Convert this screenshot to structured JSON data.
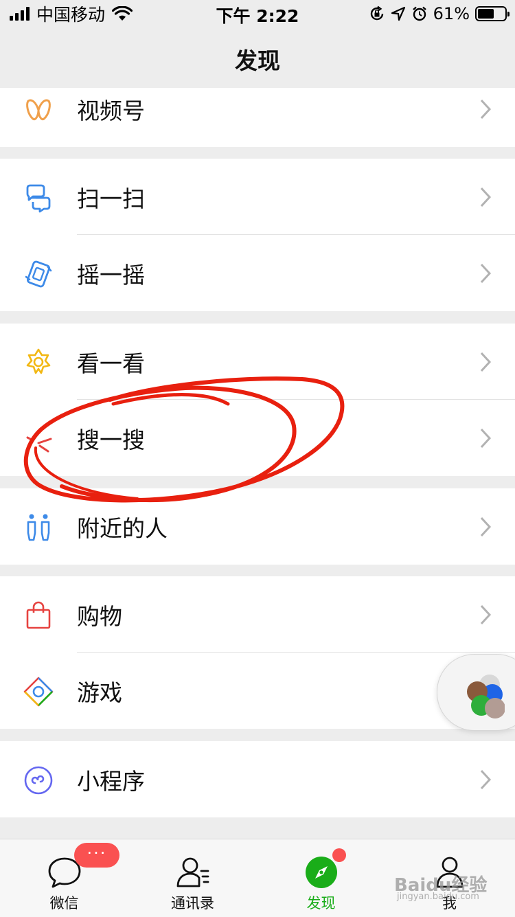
{
  "status_bar": {
    "carrier": "中国移动",
    "time": "下午 2:22",
    "battery_percent": "61%",
    "battery_level": 0.61
  },
  "nav": {
    "title": "发现"
  },
  "sections": [
    {
      "items": [
        {
          "label": "视频号",
          "icon": "channels-icon"
        }
      ]
    },
    {
      "items": [
        {
          "label": "扫一扫",
          "icon": "scan-icon"
        },
        {
          "label": "摇一摇",
          "icon": "shake-icon"
        }
      ]
    },
    {
      "items": [
        {
          "label": "看一看",
          "icon": "top-stories-icon"
        },
        {
          "label": "搜一搜",
          "icon": "search-icon"
        }
      ]
    },
    {
      "items": [
        {
          "label": "附近的人",
          "icon": "people-nearby-icon"
        }
      ]
    },
    {
      "items": [
        {
          "label": "购物",
          "icon": "shopping-bag-icon"
        },
        {
          "label": "游戏",
          "icon": "games-icon"
        }
      ]
    },
    {
      "items": [
        {
          "label": "小程序",
          "icon": "mini-program-icon"
        }
      ]
    }
  ],
  "tabbar": {
    "tabs": [
      {
        "label": "微信",
        "icon": "chat-bubble-icon",
        "badge": "···"
      },
      {
        "label": "通讯录",
        "icon": "contacts-icon"
      },
      {
        "label": "发现",
        "icon": "compass-icon",
        "active": true
      },
      {
        "label": "我",
        "icon": "me-icon"
      }
    ]
  },
  "watermark": {
    "text": "Baidu经验",
    "sub": "jingyan.baidu.com"
  },
  "colors": {
    "accent_green": "#1aad19",
    "badge_red": "#fa5151",
    "annotation_red": "#e8200f",
    "background": "#ededed"
  }
}
